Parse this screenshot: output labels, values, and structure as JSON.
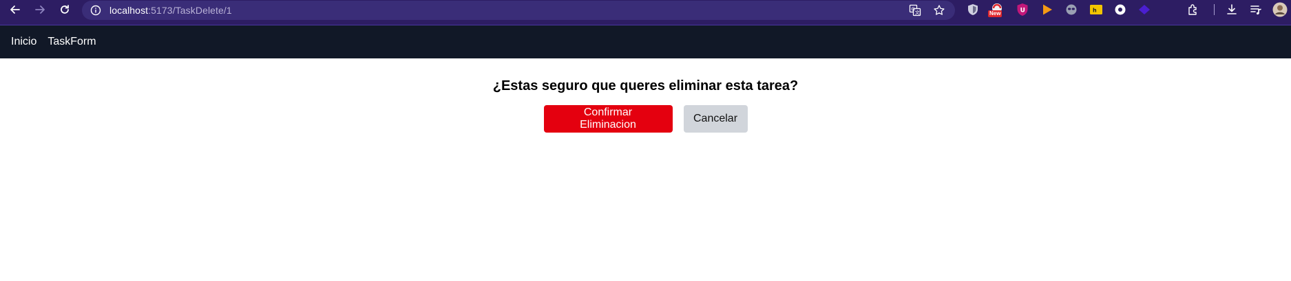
{
  "browser": {
    "url_host": "localhost",
    "url_path": ":5173/TaskDelete/1",
    "icons": {
      "back": "arrow-left-icon",
      "forward": "arrow-right-icon",
      "reload": "reload-icon",
      "site_info": "info-icon",
      "translate": "translate-icon",
      "bookmark": "star-icon",
      "download": "download-icon",
      "media": "media-queue-icon",
      "profile": "avatar"
    },
    "extensions_badge": "New",
    "colors": {
      "toolbar_bg": "#2d1d63",
      "omnibox_bg": "#3a2d78"
    }
  },
  "nav": {
    "items": [
      {
        "label": "Inicio"
      },
      {
        "label": "TaskForm"
      }
    ],
    "bg_color": "#111827"
  },
  "page": {
    "title": "¿Estas seguro que queres eliminar esta tarea?",
    "confirm_label": "Confirmar Eliminacion",
    "cancel_label": "Cancelar",
    "colors": {
      "confirm_bg": "#e4000f",
      "cancel_bg": "#d1d5db"
    }
  }
}
